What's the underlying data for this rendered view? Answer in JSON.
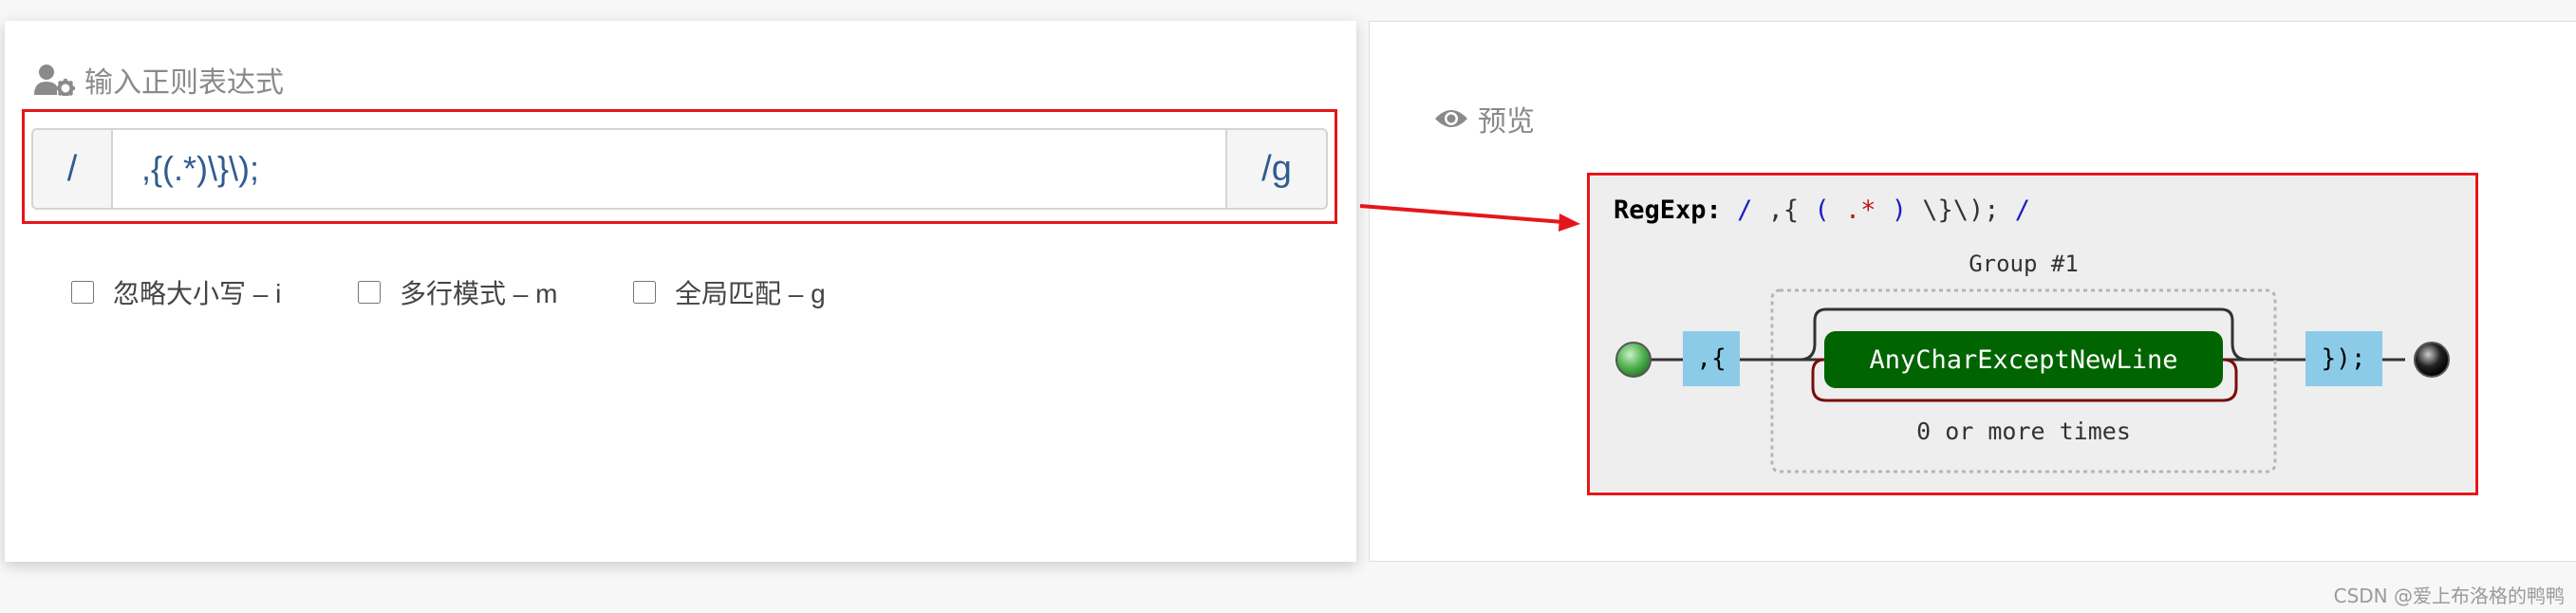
{
  "input_panel": {
    "title": "输入正则表达式",
    "prefix": "/",
    "regex_value": ",{(.*)\\}\\);",
    "suffix": "/g"
  },
  "flags": [
    {
      "label": "忽略大小写 – i",
      "checked": false
    },
    {
      "label": "多行模式 – m",
      "checked": false
    },
    {
      "label": "全局匹配 – g",
      "checked": false
    }
  ],
  "preview_panel": {
    "title": "预览",
    "regexp_label": "RegExp:",
    "regexp_slash_open": "/",
    "regexp_part1": ",{",
    "regexp_paren_open": "(",
    "regexp_part2": ".*",
    "regexp_paren_close": ")",
    "regexp_part3": "\\}\\);",
    "regexp_slash_close": "/",
    "group_label": "Group #1",
    "literal_start": ",{",
    "char_class": "AnyCharExceptNewLine",
    "repeat_label": "0 or more times",
    "literal_end": "});"
  },
  "watermark": "CSDN @爱上布洛格的鸭鸭",
  "colors": {
    "highlight_border": "#e5161b",
    "literal_fill": "#8ccbe8",
    "charset_fill": "#006400",
    "start_node": "#4fb24f",
    "end_node": "#222222"
  }
}
